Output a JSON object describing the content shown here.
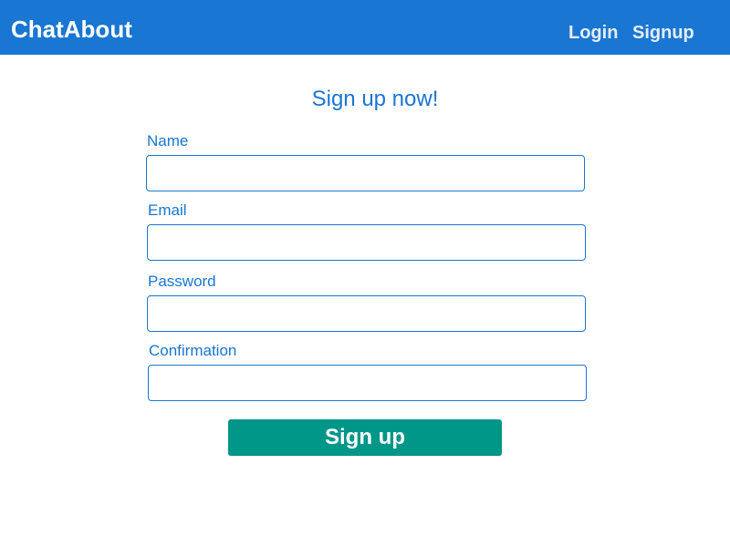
{
  "navbar": {
    "brand": "ChatAbout",
    "links": [
      {
        "label": "Login"
      },
      {
        "label": "Signup"
      }
    ],
    "background_color": "#1976d2"
  },
  "form": {
    "heading": "Sign up now!",
    "fields": [
      {
        "label": "Name",
        "value": "",
        "placeholder": ""
      },
      {
        "label": "Email",
        "value": "",
        "placeholder": ""
      },
      {
        "label": "Password",
        "value": "",
        "placeholder": ""
      },
      {
        "label": "Confirmation",
        "value": "",
        "placeholder": ""
      }
    ],
    "submit_label": "Sign up",
    "accent_color": "#1976d2",
    "submit_color": "#009688"
  }
}
